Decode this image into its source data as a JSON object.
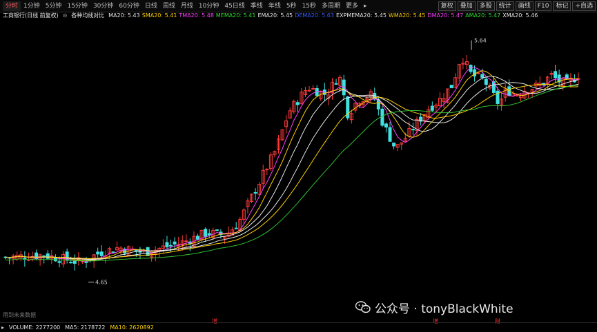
{
  "toolbar": {
    "periods": [
      "分时",
      "1分钟",
      "5分钟",
      "15分钟",
      "30分钟",
      "60分钟",
      "日线",
      "周线",
      "月线",
      "10分钟",
      "45日线",
      "季线",
      "年线",
      "5秒",
      "15秒",
      "多周期",
      "更多"
    ],
    "active_period": "分时",
    "more_arrow": "▸",
    "right_buttons": [
      "复权",
      "叠加",
      "多股",
      "统计",
      "画线",
      "F10",
      "标记",
      "+自选"
    ]
  },
  "info": {
    "stock_name": "工商银行(日线 前复权)",
    "indicator_icon": "circle-icon",
    "indicator_name": "各种均线对比",
    "values": [
      {
        "label": "MA20: 5.43",
        "color": "#e8e8e8"
      },
      {
        "label": "SMA20: 5.41",
        "color": "#ffd000"
      },
      {
        "label": "TMA20: 5.48",
        "color": "#ff40ff"
      },
      {
        "label": "MEMA20: 5.41",
        "color": "#30e030"
      },
      {
        "label": "EMA20: 5.45",
        "color": "#e8e8e8"
      },
      {
        "label": "DEMA20: 5.63",
        "color": "#3a5cff"
      },
      {
        "label": "EXPMEMA20: 5.45",
        "color": "#e8e8e8"
      },
      {
        "label": "WMA20: 5.45",
        "color": "#ffd000"
      },
      {
        "label": "DMA20: 5.47",
        "color": "#ff40ff"
      },
      {
        "label": "AMA20: 5.47",
        "color": "#30e030"
      },
      {
        "label": "XMA20: 5.46",
        "color": "#e8e8e8"
      }
    ]
  },
  "chart": {
    "high_label": "5.64",
    "low_label": "4.65",
    "future_note": "用到未来数据",
    "markers": [
      "增",
      "增",
      "财"
    ]
  },
  "footer": {
    "arrow": "▸",
    "volume": "VOLUME: 2277200",
    "ma5": "MA5: 2178722",
    "ma10": "MA10: 2620892"
  },
  "watermark": {
    "text": "公众号 · tonyBlackWhite",
    "icon": "wechat-icon"
  },
  "colors": {
    "up": "#ff3a3a",
    "down": "#40e0e0",
    "ma_white": "#e8e8e8",
    "ma_yellow": "#ffd000",
    "ma_magenta": "#ff40ff",
    "ma_green": "#30c030"
  }
}
